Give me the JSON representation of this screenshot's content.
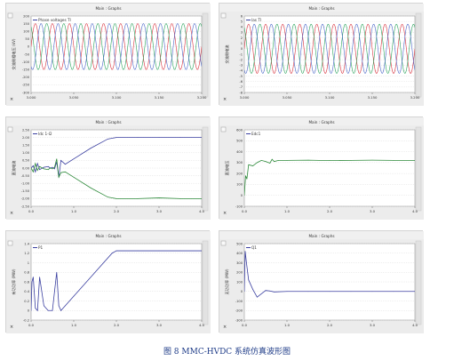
{
  "panel_title": "Main : Graphs",
  "colors": {
    "phase_a": "#d8323e",
    "phase_b": "#2aa35c",
    "phase_c": "#4a66c8",
    "blue": "#3a3fa0",
    "green": "#2d8a3a",
    "caption": "#1f3c88",
    "plot_bg": "#ffffff",
    "frame": "#d4d4d4",
    "grid": "#d6d6d6"
  },
  "chart_data": [
    {
      "type": "line",
      "title": "Main : Graphs",
      "legend": [
        "Phase voltages TI"
      ],
      "ylabel": "交流侧相电压 (kV)",
      "ylim": [
        -300,
        200
      ],
      "yticks": [
        200,
        150,
        100,
        50,
        0,
        -50,
        -100,
        -150,
        -200,
        -250,
        -300
      ],
      "xlim": [
        3.0,
        3.2
      ],
      "xticks": [
        "3.000",
        "3.050",
        "3.100",
        "3.150",
        "3.200"
      ],
      "waveform": {
        "kind": "three_phase_sine",
        "amplitude": 150,
        "cycles": 10
      }
    },
    {
      "type": "line",
      "title": "Main : Graphs",
      "legend": [
        "Ias TI"
      ],
      "ylabel": "交流侧电流",
      "ylim": [
        -8,
        6
      ],
      "yticks": [
        6.0,
        5.0,
        4.0,
        3.0,
        2.0,
        1.0,
        0.0,
        -1.0,
        -2.0,
        -3.0,
        -4.0,
        -5.0,
        -6.0,
        -7.0,
        -8.0
      ],
      "xlim": [
        3.0,
        3.2
      ],
      "xticks": [
        "3.000",
        "3.050",
        "3.100",
        "3.150",
        "3.200"
      ],
      "waveform": {
        "kind": "three_phase_sine",
        "amplitude": 4.5,
        "cycles": 10
      }
    },
    {
      "type": "line",
      "title": "Main : Graphs",
      "legend": [
        "Idc 1-I2"
      ],
      "ylabel": "直流电流",
      "ylim": [
        -2.5,
        2.5
      ],
      "yticks": [
        "2.50",
        "2.00",
        "1.50",
        "1.00",
        "0.50",
        "0.00",
        "-0.50",
        "-1.00",
        "-1.50",
        "-2.00",
        "-2.50"
      ],
      "xlim": [
        0,
        4
      ],
      "xticks": [
        "0.0",
        "1.0",
        "2.0",
        "3.0",
        "4.0"
      ],
      "series": [
        {
          "color_key": "blue",
          "x": [
            0,
            0.05,
            0.1,
            0.15,
            0.2,
            0.3,
            0.4,
            0.45,
            0.5,
            0.55,
            0.6,
            0.65,
            0.7,
            0.8,
            1.0,
            1.4,
            1.8,
            2.0,
            2.5,
            3.0,
            3.5,
            4.0
          ],
          "y": [
            0.0,
            0.15,
            -0.25,
            0.3,
            -0.1,
            0.05,
            0.1,
            0.0,
            0.05,
            -0.05,
            0.4,
            -0.6,
            0.5,
            0.25,
            0.6,
            1.3,
            1.9,
            2.0,
            2.0,
            2.0,
            2.0,
            2.0
          ]
        },
        {
          "color_key": "green",
          "x": [
            0,
            0.05,
            0.1,
            0.15,
            0.2,
            0.3,
            0.4,
            0.45,
            0.5,
            0.55,
            0.6,
            0.65,
            0.7,
            0.8,
            1.0,
            1.4,
            1.8,
            2.0,
            2.5,
            3.0,
            3.5,
            4.0
          ],
          "y": [
            0.0,
            -0.25,
            0.3,
            -0.15,
            0.1,
            -0.05,
            -0.1,
            0.0,
            -0.05,
            0.05,
            0.6,
            -0.6,
            -0.3,
            -0.25,
            -0.6,
            -1.3,
            -1.9,
            -2.0,
            -2.0,
            -1.95,
            -2.0,
            -2.0
          ]
        }
      ]
    },
    {
      "type": "line",
      "title": "Main : Graphs",
      "legend": [
        "Edc1"
      ],
      "ylabel": "直流电压",
      "ylim": [
        -100,
        600
      ],
      "yticks": [
        600,
        500,
        400,
        300,
        200,
        100,
        0,
        -100
      ],
      "xlim": [
        0,
        4
      ],
      "xticks": [
        "0.0",
        "1.0",
        "2.0",
        "3.0",
        "4.0"
      ],
      "series": [
        {
          "color_key": "green",
          "x": [
            0,
            0.03,
            0.06,
            0.1,
            0.2,
            0.3,
            0.4,
            0.5,
            0.6,
            0.65,
            0.7,
            0.8,
            1.0,
            1.5,
            2.0,
            2.5,
            3.0,
            3.5,
            4.0
          ],
          "y": [
            0,
            180,
            150,
            280,
            270,
            300,
            320,
            310,
            295,
            330,
            310,
            320,
            320,
            322,
            318,
            320,
            322,
            320,
            320
          ]
        }
      ]
    },
    {
      "type": "line",
      "title": "Main : Graphs",
      "legend": [
        "P1"
      ],
      "ylabel": "有功功率 (MW)",
      "ylim": [
        -0.2,
        1.4
      ],
      "yticks": [
        1.4,
        1.2,
        1.0,
        0.8,
        0.6,
        0.4,
        0.2,
        0.0,
        -0.2
      ],
      "xlim": [
        0,
        4
      ],
      "xticks": [
        "0.0",
        "1.0",
        "2.0",
        "3.0",
        "4.0"
      ],
      "series": [
        {
          "color_key": "blue",
          "x": [
            0,
            0.02,
            0.05,
            0.1,
            0.15,
            0.2,
            0.3,
            0.4,
            0.5,
            0.55,
            0.6,
            0.65,
            0.7,
            0.8,
            1.0,
            1.5,
            1.9,
            2.0,
            2.5,
            3.0,
            3.5,
            4.0
          ],
          "y": [
            0.0,
            0.6,
            0.7,
            0.05,
            0.0,
            0.7,
            0.1,
            0.0,
            0.0,
            0.4,
            0.8,
            0.1,
            0.0,
            0.1,
            0.3,
            0.8,
            1.2,
            1.25,
            1.25,
            1.25,
            1.25,
            1.25
          ]
        }
      ]
    },
    {
      "type": "line",
      "title": "Main : Graphs",
      "legend": [
        "Q1"
      ],
      "ylabel": "无功功率 (MW)",
      "ylim": [
        -300,
        500
      ],
      "yticks": [
        500,
        400,
        300,
        200,
        100,
        0,
        -100,
        -200,
        -300
      ],
      "xlim": [
        0,
        4
      ],
      "xticks": [
        "0.0",
        "1.0",
        "2.0",
        "3.0",
        "4.0"
      ],
      "series": [
        {
          "color_key": "blue",
          "x": [
            0,
            0.02,
            0.05,
            0.1,
            0.2,
            0.3,
            0.5,
            0.6,
            0.7,
            1.0,
            1.5,
            2.0,
            2.5,
            3.0,
            3.5,
            4.0
          ],
          "y": [
            0,
            420,
            300,
            120,
            20,
            -60,
            10,
            5,
            -5,
            0,
            0,
            0,
            0,
            0,
            0,
            0
          ]
        }
      ]
    }
  ],
  "caption": "图 8   MMC-HVDC 系统仿真波形图"
}
